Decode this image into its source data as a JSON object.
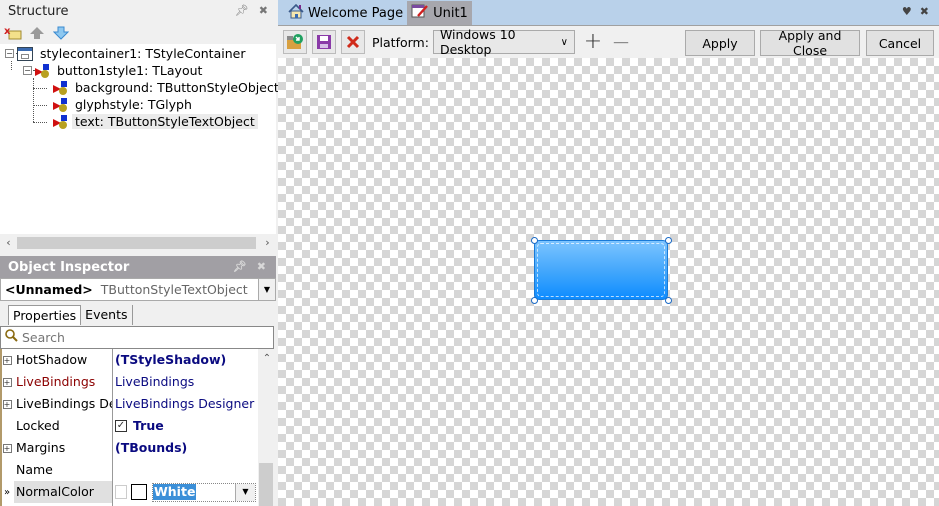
{
  "structure": {
    "title": "Structure",
    "toolbar_icons": [
      "delete-icon",
      "move-up-icon",
      "move-down-icon"
    ],
    "tree": [
      {
        "label": "stylecontainer1: TStyleContainer",
        "icon": "form-icon",
        "level": 0,
        "expanded": true
      },
      {
        "label": "button1style1: TLayout",
        "icon": "component-icon",
        "level": 1,
        "expanded": true
      },
      {
        "label": "background: TButtonStyleObject",
        "icon": "component-icon",
        "level": 2
      },
      {
        "label": "glyphstyle: TGlyph",
        "icon": "component-icon",
        "level": 2
      },
      {
        "label": "text: TButtonStyleTextObject",
        "icon": "component-icon",
        "level": 2,
        "selected": true
      }
    ]
  },
  "object_inspector": {
    "title": "Object Inspector",
    "selected_name": "<Unnamed>",
    "selected_type": "TButtonStyleTextObject",
    "tabs": [
      "Properties",
      "Events"
    ],
    "active_tab": "Properties",
    "search_placeholder": "Search",
    "properties": [
      {
        "name": "HotShadow",
        "value": "(TStyleShadow)",
        "expandable": true,
        "bold": true
      },
      {
        "name": "LiveBindings",
        "value": "LiveBindings",
        "expandable": true,
        "name_color": "#8b0000"
      },
      {
        "name": "LiveBindings Designer",
        "value": "LiveBindings Designer",
        "expandable": true
      },
      {
        "name": "Locked",
        "value": "True",
        "checkbox": true,
        "bold": true
      },
      {
        "name": "Margins",
        "value": "(TBounds)",
        "expandable": true,
        "bold": true
      },
      {
        "name": "Name",
        "value": ""
      },
      {
        "name": "NormalColor",
        "value": "White",
        "selected": true,
        "color_editor": true
      }
    ]
  },
  "document_tabs": [
    {
      "label": "Welcome Page",
      "icon": "home-icon",
      "active": false
    },
    {
      "label": "Unit1",
      "icon": "form-edit-icon",
      "active": true
    }
  ],
  "toolbar": {
    "platform_label": "Platform:",
    "platform_value": "Windows 10 Desktop",
    "zoom_in": "+",
    "zoom_out": "—",
    "apply_label": "Apply",
    "apply_close_label": "Apply and Close",
    "cancel_label": "Cancel"
  },
  "colors": {
    "tab_bar": "#b9d1ea",
    "active_tab": "#a7a7ad",
    "inspector_header": "#a19fa4",
    "button_preview_top": "#7cc4ff",
    "button_preview_bottom": "#0d8cff",
    "selection": "#3b8fd8"
  }
}
